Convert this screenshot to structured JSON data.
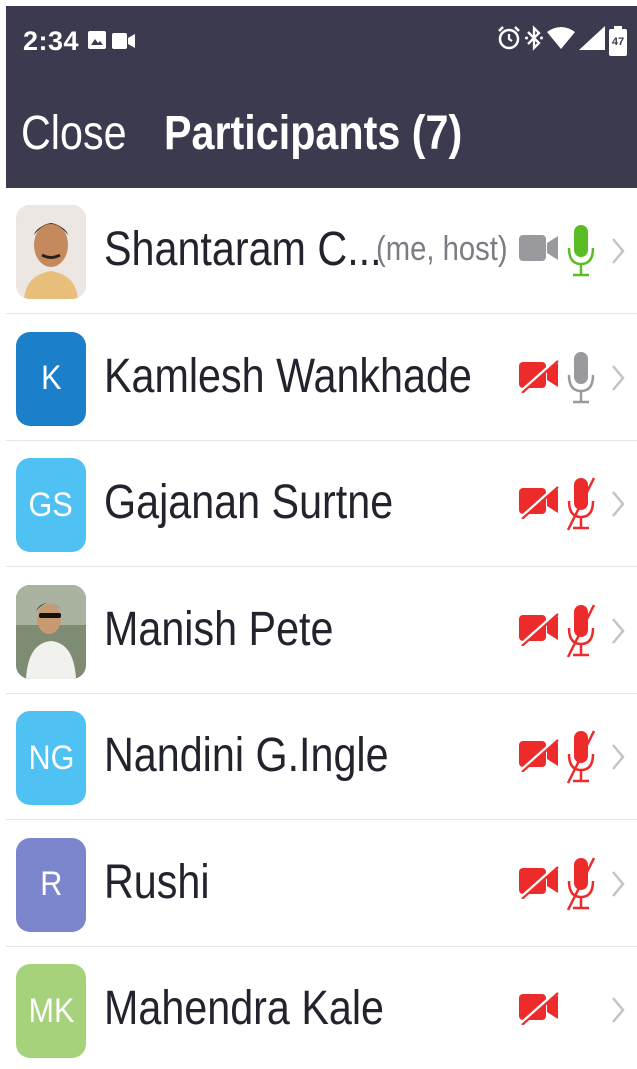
{
  "status_bar": {
    "time": "2:34",
    "battery": "47",
    "left_icons": [
      "image-icon",
      "video-icon"
    ],
    "right_icons": [
      "alarm-icon",
      "bluetooth-icon",
      "wifi-icon",
      "signal-icon",
      "battery-icon"
    ]
  },
  "header": {
    "close_label": "Close",
    "title": "Participants (7)"
  },
  "colors": {
    "header_bg": "#3b3a4e",
    "muted_red": "#ee2b2b",
    "mic_green": "#5bbd26",
    "icon_gray": "#9a9a9e"
  },
  "participants": [
    {
      "name": "Shantaram C...",
      "tag": "(me, host)",
      "avatar_type": "photo",
      "initials": "",
      "avatar_color": "#d9b187",
      "video": "on",
      "mic": "speaking"
    },
    {
      "name": "Kamlesh Wankhade",
      "tag": "",
      "avatar_type": "initials",
      "initials": "K",
      "avatar_color": "#1b7fca",
      "video": "off",
      "mic": "on"
    },
    {
      "name": "Gajanan Surtne",
      "tag": "",
      "avatar_type": "initials",
      "initials": "GS",
      "avatar_color": "#4fc1f2",
      "video": "off",
      "mic": "off"
    },
    {
      "name": "Manish Pete",
      "tag": "",
      "avatar_type": "photo",
      "initials": "",
      "avatar_color": "#8a9a86",
      "video": "off",
      "mic": "off"
    },
    {
      "name": "Nandini G.Ingle",
      "tag": "",
      "avatar_type": "initials",
      "initials": "NG",
      "avatar_color": "#4fc1f2",
      "video": "off",
      "mic": "off"
    },
    {
      "name": "Rushi",
      "tag": "",
      "avatar_type": "initials",
      "initials": "R",
      "avatar_color": "#7c86cc",
      "video": "off",
      "mic": "off"
    },
    {
      "name": "Mahendra Kale",
      "tag": "",
      "avatar_type": "initials",
      "initials": "MK",
      "avatar_color": "#a6d27b",
      "video": "off",
      "mic": "none"
    }
  ]
}
